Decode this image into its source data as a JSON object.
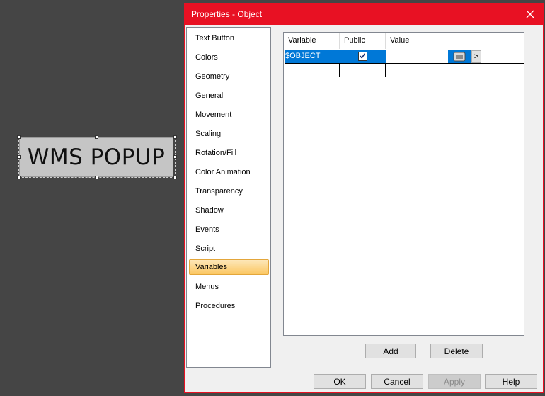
{
  "canvas": {
    "object_text": "WMS POPUP"
  },
  "dialog": {
    "title": "Properties - Object",
    "nav": [
      {
        "label": "Text Button"
      },
      {
        "label": "Colors"
      },
      {
        "label": "Geometry"
      },
      {
        "label": "General"
      },
      {
        "label": "Movement"
      },
      {
        "label": "Scaling"
      },
      {
        "label": "Rotation/Fill"
      },
      {
        "label": "Color Animation"
      },
      {
        "label": "Transparency"
      },
      {
        "label": "Shadow"
      },
      {
        "label": "Events"
      },
      {
        "label": "Script"
      },
      {
        "label": "Variables",
        "active": true
      },
      {
        "label": "Menus"
      },
      {
        "label": "Procedures"
      }
    ],
    "grid": {
      "columns": [
        "Variable",
        "Public",
        "Value"
      ],
      "rows": [
        {
          "variable": "$OBJECT",
          "public": true,
          "value": ""
        }
      ],
      "expand_label": ">"
    },
    "buttons": {
      "add": "Add",
      "delete": "Delete",
      "ok": "OK",
      "cancel": "Cancel",
      "apply": "Apply",
      "help": "Help"
    }
  },
  "colors": {
    "accent": "#e81123",
    "selection": "#0078d7"
  }
}
